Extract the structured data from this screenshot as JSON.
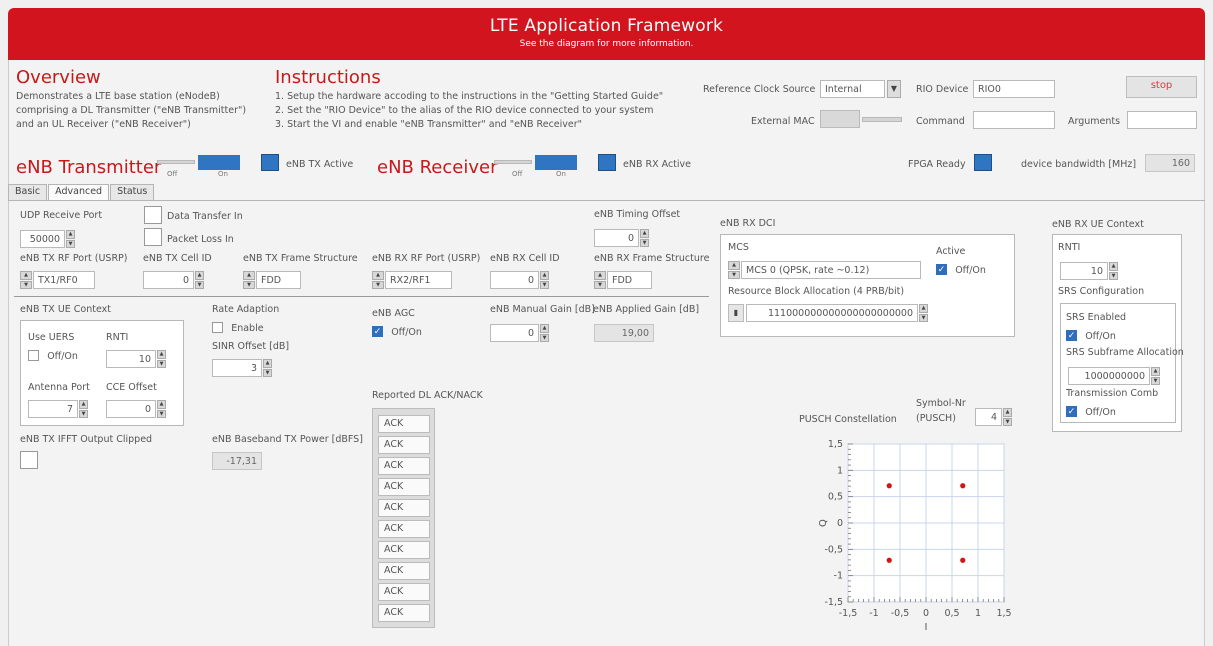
{
  "header": {
    "title": "LTE Application Framework",
    "subtitle": "See the diagram for more information."
  },
  "overview": {
    "title": "Overview",
    "lines": [
      "Demonstrates a LTE base station (eNodeB)",
      "comprising a DL Transmitter (\"eNB Transmitter\")",
      "and an UL Receiver (\"eNB Receiver\")"
    ]
  },
  "instructions": {
    "title": "Instructions",
    "lines": [
      "1. Setup the hardware accoding to the instructions in the \"Getting Started Guide\"",
      "2. Set the \"RIO Device\" to the alias of the RIO device connected to your system",
      "3. Start the VI and enable \"eNB Transmitter\" and \"eNB Receiver\""
    ]
  },
  "config": {
    "ref_clock_label": "Reference Clock Source",
    "ref_clock_value": "Internal",
    "rio_device_label": "RIO Device",
    "rio_device_value": "RIO0",
    "stop_label": "stop",
    "external_mac_label": "External MAC",
    "command_label": "Command",
    "command_value": "",
    "arguments_label": "Arguments",
    "arguments_value": "",
    "fpga_ready_label": "FPGA Ready",
    "bandwidth_label": "device bandwidth [MHz]",
    "bandwidth_value": "160"
  },
  "transmitter": {
    "title": "eNB Transmitter",
    "toggle_off": "Off",
    "toggle_on": "On",
    "active_label": "eNB TX Active"
  },
  "receiver": {
    "title": "eNB Receiver",
    "toggle_off": "Off",
    "toggle_on": "On",
    "active_label": "eNB RX Active"
  },
  "tabs": [
    {
      "label": "Basic"
    },
    {
      "label": "Advanced"
    },
    {
      "label": "Status"
    }
  ],
  "advanced": {
    "udp_port_label": "UDP Receive Port",
    "udp_port_value": "50000",
    "data_transfer_label": "Data Transfer In",
    "packet_loss_label": "Packet Loss In",
    "timing_offset_label": "eNB Timing Offset",
    "timing_offset_value": "0",
    "tx_rf_port_label": "eNB TX RF Port (USRP)",
    "tx_rf_port_value": "TX1/RF0",
    "tx_cell_id_label": "eNB TX Cell ID",
    "tx_cell_id_value": "0",
    "tx_frame_label": "eNB TX Frame Structure",
    "tx_frame_value": "FDD",
    "rx_rf_port_label": "eNB RX RF Port (USRP)",
    "rx_rf_port_value": "RX2/RF1",
    "rx_cell_id_label": "eNB RX Cell ID",
    "rx_cell_id_value": "0",
    "rx_frame_label": "eNB RX Frame Structure",
    "rx_frame_value": "FDD",
    "tx_ue_context_label": "eNB TX UE Context",
    "use_uers_label": "Use UERS",
    "use_uers_check": "Off/On",
    "rnti_label": "RNTI",
    "rnti_value": "10",
    "antenna_port_label": "Antenna Port",
    "antenna_port_value": "7",
    "cce_offset_label": "CCE Offset",
    "cce_offset_value": "0",
    "rate_adaption_label": "Rate Adaption",
    "rate_enable_label": "Enable",
    "sinr_offset_label": "SINR Offset [dB]",
    "sinr_offset_value": "3",
    "agc_label": "eNB AGC",
    "agc_check": "Off/On",
    "manual_gain_label": "eNB Manual Gain [dB]",
    "manual_gain_value": "0",
    "applied_gain_label": "eNB Applied Gain [dB]",
    "applied_gain_value": "19,00",
    "ifft_clipped_label": "eNB TX IFFT Output Clipped",
    "baseband_power_label": "eNB Baseband TX Power [dBFS]",
    "baseband_power_value": "-17,31",
    "ack_label": "Reported DL ACK/NACK",
    "ack_list": [
      "ACK",
      "ACK",
      "ACK",
      "ACK",
      "ACK",
      "ACK",
      "ACK",
      "ACK",
      "ACK",
      "ACK"
    ]
  },
  "rx_dci": {
    "title": "eNB RX DCI",
    "mcs_label": "MCS",
    "mcs_value": "MCS 0 (QPSK, rate ~0.12)",
    "active_label": "Active",
    "active_check": "Off/On",
    "rb_alloc_label": "Resource Block Allocation (4 PRB/bit)",
    "rb_alloc_value": "111000000000000000000000"
  },
  "ue_context": {
    "title": "eNB RX UE Context",
    "rnti_label": "RNTI",
    "rnti_value": "10",
    "srs_config_label": "SRS Configuration",
    "srs_enabled_label": "SRS Enabled",
    "srs_enabled_check": "Off/On",
    "srs_subframe_label": "SRS Subframe Allocation",
    "srs_subframe_value": "1000000000",
    "transmission_comb_label": "Transmission Comb",
    "transmission_comb_check": "Off/On"
  },
  "constellation": {
    "symbol_label_1": "Symbol-Nr",
    "symbol_label_2": "(PUSCH)",
    "symbol_value": "4",
    "title": "PUSCH Constellation",
    "chart_data": {
      "type": "scatter",
      "title": "PUSCH Constellation",
      "xlabel": "I",
      "ylabel": "Q",
      "xlim": [
        -1.5,
        1.5
      ],
      "ylim": [
        -1.5,
        1.5
      ],
      "xticks": [
        "-1,5",
        "-1",
        "-0,5",
        "0",
        "0,5",
        "1",
        "1,5"
      ],
      "yticks": [
        "1,5",
        "1",
        "0,5",
        "0",
        "-0,5",
        "-1",
        "-1,5"
      ],
      "grid": true,
      "points": [
        {
          "x": -0.707,
          "y": 0.707
        },
        {
          "x": 0.707,
          "y": 0.707
        },
        {
          "x": -0.707,
          "y": -0.707
        },
        {
          "x": 0.707,
          "y": -0.707
        }
      ],
      "point_color": "#d21414"
    }
  }
}
